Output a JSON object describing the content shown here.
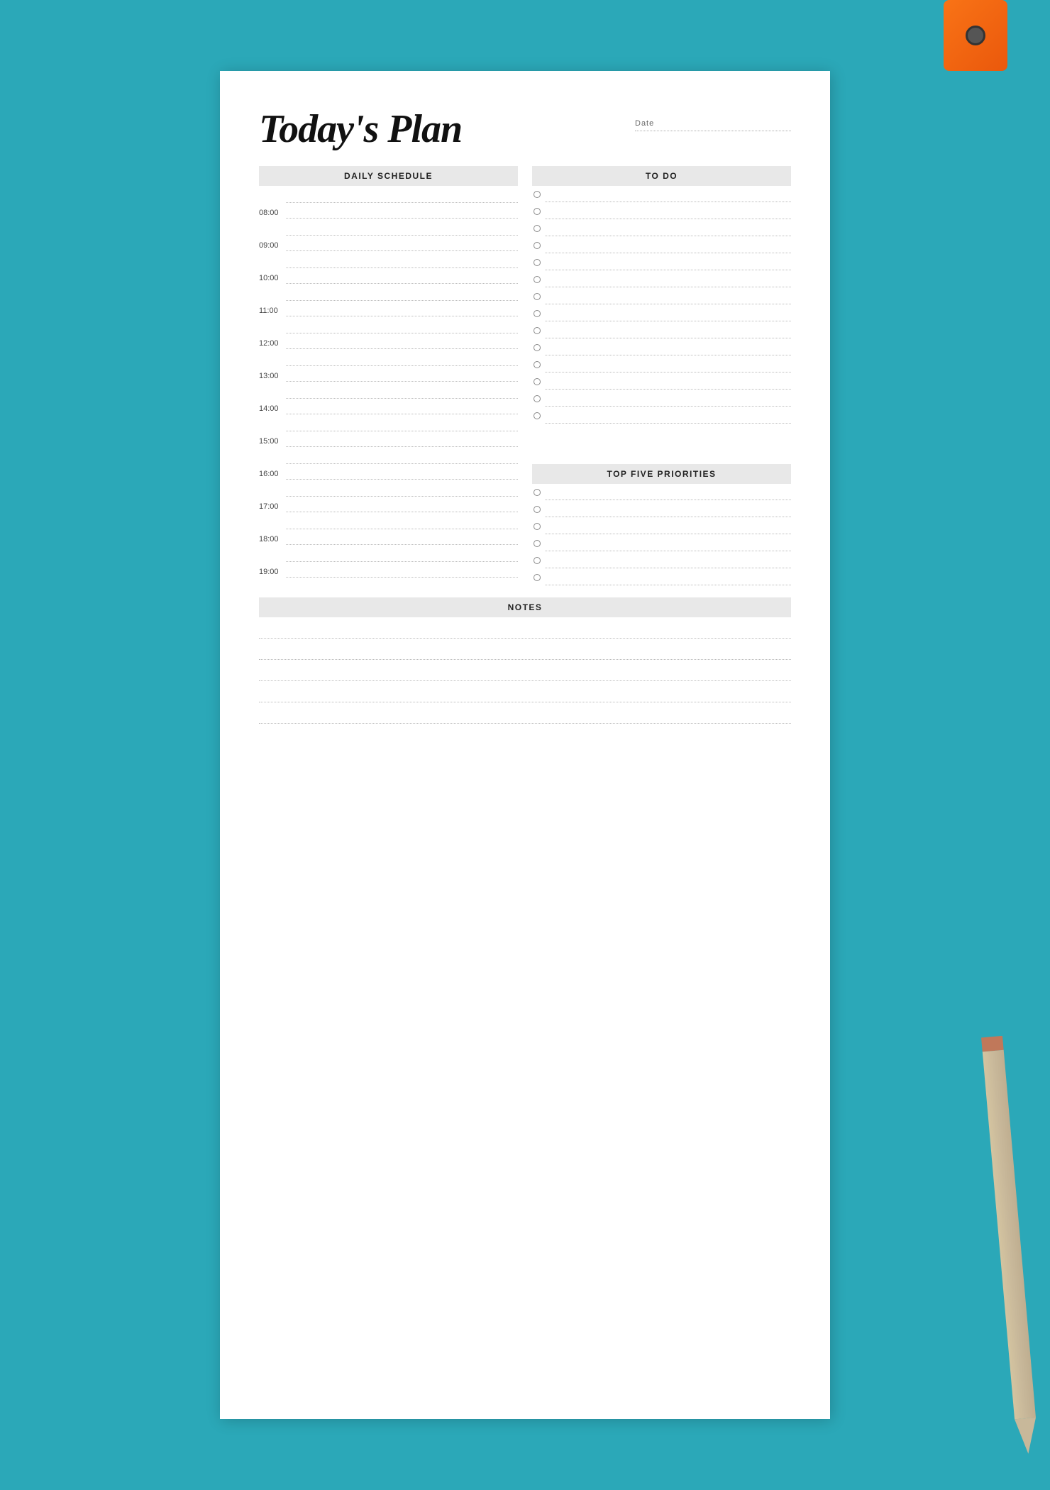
{
  "page": {
    "background_color": "#2ba8b8"
  },
  "header": {
    "title": "Today's Plan",
    "date_label": "Date"
  },
  "daily_schedule": {
    "section_label": "DAILY SCHEDULE",
    "times": [
      "08:00",
      "09:00",
      "10:00",
      "11:00",
      "12:00",
      "13:00",
      "14:00",
      "15:00",
      "16:00",
      "17:00",
      "18:00",
      "19:00"
    ]
  },
  "todo": {
    "section_label": "TO DO",
    "items_count": 14
  },
  "top_five_priorities": {
    "section_label": "TOP FIVE PRIORITIES",
    "items_count": 6
  },
  "notes": {
    "section_label": "NOTES",
    "lines_count": 5
  }
}
